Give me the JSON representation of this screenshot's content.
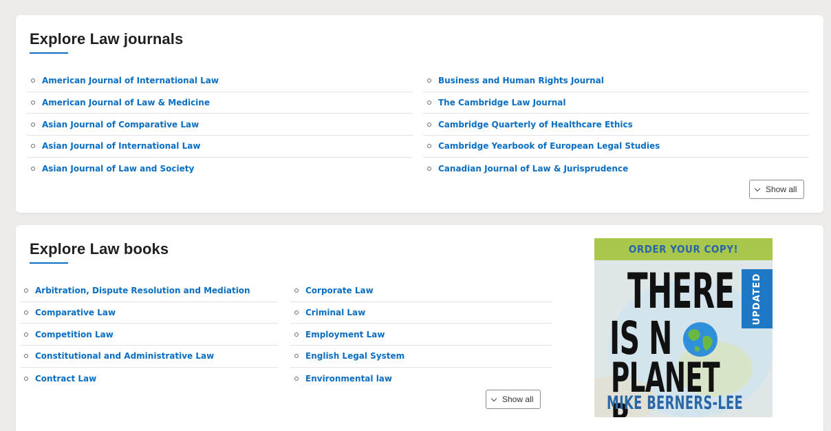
{
  "journals": {
    "heading": "Explore Law journals",
    "left_items": [
      "American Journal of International Law",
      "American Journal of Law & Medicine",
      "Asian Journal of Comparative Law",
      "Asian Journal of International Law",
      "Asian Journal of Law and Society"
    ],
    "right_items": [
      "Business and Human Rights Journal",
      "The Cambridge Law Journal",
      "Cambridge Quarterly of Healthcare Ethics",
      "Cambridge Yearbook of European Legal Studies",
      "Canadian Journal of Law & Jurisprudence"
    ],
    "show_all_label": "Show all"
  },
  "books": {
    "heading": "Explore Law books",
    "left_items": [
      "Arbitration, Dispute Resolution and Mediation",
      "Comparative Law",
      "Competition Law",
      "Constitutional and Administrative Law",
      "Contract Law"
    ],
    "right_items": [
      "Corporate Law",
      "Criminal Law",
      "Employment Law",
      "English Legal System",
      "Environmental law"
    ],
    "show_all_label": "Show all"
  },
  "ad": {
    "banner": "ORDER YOUR COPY!",
    "title_line1": "THERE",
    "title_line2": "IS N",
    "title_line3": "PLANET B",
    "badge": "UPDATED",
    "author": "MIKE BERNERS-LEE"
  },
  "colors": {
    "link": "#0a6ec2",
    "accent": "#0a6ec2",
    "ad_banner": "#a9c84b",
    "ad_badge": "#1f78c4"
  },
  "icons": [
    "bullet-icon",
    "chevron-down-icon",
    "globe-icon"
  ]
}
